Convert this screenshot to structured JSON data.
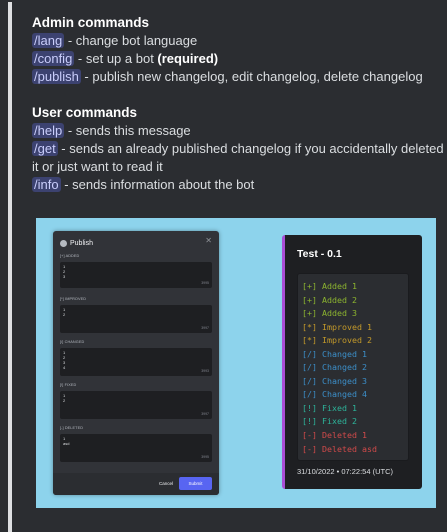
{
  "colors": {
    "added": "#8cb42f",
    "improved": "#c49a2a",
    "changed": "#3c8ec8",
    "fixed": "#2db49a",
    "deleted": "#d14a4a",
    "accent": "#a94ed6"
  },
  "admin": {
    "title": "Admin commands",
    "commands": [
      {
        "cmd": "/lang",
        "desc": " - change bot language",
        "extra": ""
      },
      {
        "cmd": "/config",
        "desc": " - set up a bot ",
        "extra": "(required)"
      },
      {
        "cmd": "/publish",
        "desc": " - publish new changelog, edit changelog, delete changelog",
        "extra": ""
      }
    ]
  },
  "user": {
    "title": "User commands",
    "commands": [
      {
        "cmd": "/help",
        "desc": " - sends this message"
      },
      {
        "cmd": "/get",
        "desc": " - sends an already published changelog if you accidentally deleted it or just want to read it"
      },
      {
        "cmd": "/info",
        "desc": " - sends information about the bot"
      }
    ]
  },
  "modal": {
    "title": "Publish",
    "close": "✕",
    "fields": [
      {
        "label": "[+] ADDED",
        "lines": [
          "1",
          "2",
          "3"
        ],
        "count": "3995"
      },
      {
        "label": "[*] IMPROVED",
        "lines": [
          "1",
          "2"
        ],
        "count": "3997"
      },
      {
        "label": "[/] CHANGED",
        "lines": [
          "1",
          "2",
          "3",
          "4"
        ],
        "count": "3993"
      },
      {
        "label": "[!] FIXED",
        "lines": [
          "1",
          "2"
        ],
        "count": "3997"
      },
      {
        "label": "[-] DELETED",
        "lines": [
          "1",
          "asd"
        ],
        "count": "3995"
      }
    ],
    "cancel": "Cancel",
    "submit": "Submit"
  },
  "card": {
    "title": "Test - 0.1",
    "lines": [
      {
        "mark": "[+]",
        "text": " Added 1",
        "kind": "added"
      },
      {
        "mark": "[+]",
        "text": " Added 2",
        "kind": "added"
      },
      {
        "mark": "[+]",
        "text": " Added 3",
        "kind": "added"
      },
      {
        "mark": "[*]",
        "text": " Improved 1",
        "kind": "improved"
      },
      {
        "mark": "[*]",
        "text": " Improved 2",
        "kind": "improved"
      },
      {
        "mark": "[/]",
        "text": " Changed 1",
        "kind": "changed"
      },
      {
        "mark": "[/]",
        "text": " Changed 2",
        "kind": "changed"
      },
      {
        "mark": "[/]",
        "text": " Changed 3",
        "kind": "changed"
      },
      {
        "mark": "[/]",
        "text": " Changed 4",
        "kind": "changed"
      },
      {
        "mark": "[!]",
        "text": " Fixed 1",
        "kind": "fixed"
      },
      {
        "mark": "[!]",
        "text": " Fixed 2",
        "kind": "fixed"
      },
      {
        "mark": "[-]",
        "text": " Deleted 1",
        "kind": "deleted"
      },
      {
        "mark": "[-]",
        "text": " Deleted asd",
        "kind": "deleted"
      }
    ],
    "footer": "31/10/2022 • 07:22:54 (UTC)"
  }
}
